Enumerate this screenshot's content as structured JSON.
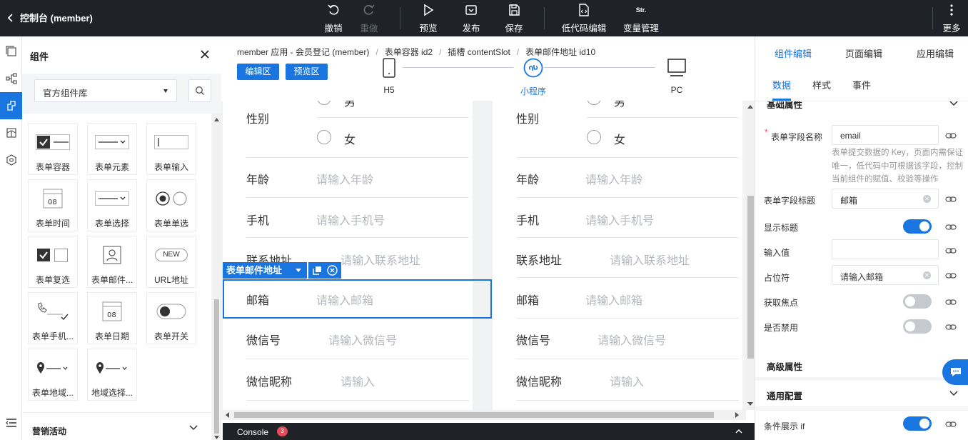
{
  "app": {
    "title": "控制台 (member)"
  },
  "toolbar": {
    "undo": "撤销",
    "redo": "重做",
    "preview": "预览",
    "publish": "发布",
    "save": "保存",
    "lowcode": "低代码编辑",
    "variables": "变量管理",
    "more": "更多",
    "str_icon_text": "Str."
  },
  "left_panel": {
    "title": "组件",
    "library_select": "官方组件库",
    "components": [
      {
        "label": "表单容器",
        "icon": "checkbox-line-icon"
      },
      {
        "label": "表单元素",
        "icon": "line-dropdown-icon"
      },
      {
        "label": "表单输入",
        "icon": "input-box-icon"
      },
      {
        "label": "表单时间",
        "icon": "clock-calendar-icon"
      },
      {
        "label": "表单选择",
        "icon": "line-dropdown-icon"
      },
      {
        "label": "表单单选",
        "icon": "radio-pair-icon"
      },
      {
        "label": "表单复选",
        "icon": "checkbox-pair-icon"
      },
      {
        "label": "表单邮件...",
        "icon": "person-card-icon"
      },
      {
        "label": "URL地址",
        "icon": "new-badge-icon"
      },
      {
        "label": "表单手机...",
        "icon": "phone-check-icon"
      },
      {
        "label": "表单日期",
        "icon": "calendar-icon"
      },
      {
        "label": "表单开关",
        "icon": "switch-icon"
      },
      {
        "label": "表单地域...",
        "icon": "pin-dropdown-icon"
      },
      {
        "label": "地域选择...",
        "icon": "pin-dropdown-icon"
      }
    ],
    "new_badge": "NEW",
    "date_glyph": "08",
    "marketing": "营销活动"
  },
  "center": {
    "breadcrumb": [
      "member 应用 - 会员登记 (member)",
      "表单容器 id2",
      "插槽 contentSlot",
      "表单邮件地址 id10"
    ],
    "edit_btn": "编辑区",
    "preview_btn": "预览区",
    "devices": [
      "H5",
      "小程序",
      "PC"
    ],
    "form": {
      "gender_label": "性别",
      "male": "男",
      "female": "女",
      "rows": [
        {
          "label": "年龄",
          "placeholder": "请输入年龄"
        },
        {
          "label": "手机",
          "placeholder": "请输入手机号"
        },
        {
          "label": "联系地址",
          "placeholder": "请输入联系地址"
        },
        {
          "label": "邮箱",
          "placeholder": "请输入邮箱"
        },
        {
          "label": "微信号",
          "placeholder": "请输入微信号"
        },
        {
          "label": "微信昵称",
          "placeholder": "请输入"
        }
      ]
    },
    "selected_component": "表单邮件地址",
    "console": "Console",
    "console_count": "3"
  },
  "right_panel": {
    "tabs": [
      "组件编辑",
      "页面编辑",
      "应用编辑"
    ],
    "subtabs": [
      "数据",
      "样式",
      "事件"
    ],
    "basic_section": "基础属性",
    "props": {
      "field_name_label": "表单字段名称",
      "field_name_value": "email",
      "field_name_help": "表单提交数据的 Key，页面内需保证唯一，低代码中可根据该字段，控制当前组件的赋值、校验等操作",
      "field_title_label": "表单字段标题",
      "field_title_value": "邮箱",
      "show_title_label": "显示标题",
      "show_title_on": true,
      "input_value_label": "输入值",
      "input_value": "",
      "placeholder_label": "占位符",
      "placeholder_value": "请输入邮箱",
      "focus_label": "获取焦点",
      "focus_on": false,
      "disabled_label": "是否禁用",
      "disabled_on": false
    },
    "advanced_section": "高级属性",
    "common_section": "通用配置",
    "condition_label": "条件展示 if",
    "condition_on": true
  },
  "colors": {
    "accent": "#1976e1",
    "topbar": "#1f2227",
    "badge": "#e34d59"
  }
}
